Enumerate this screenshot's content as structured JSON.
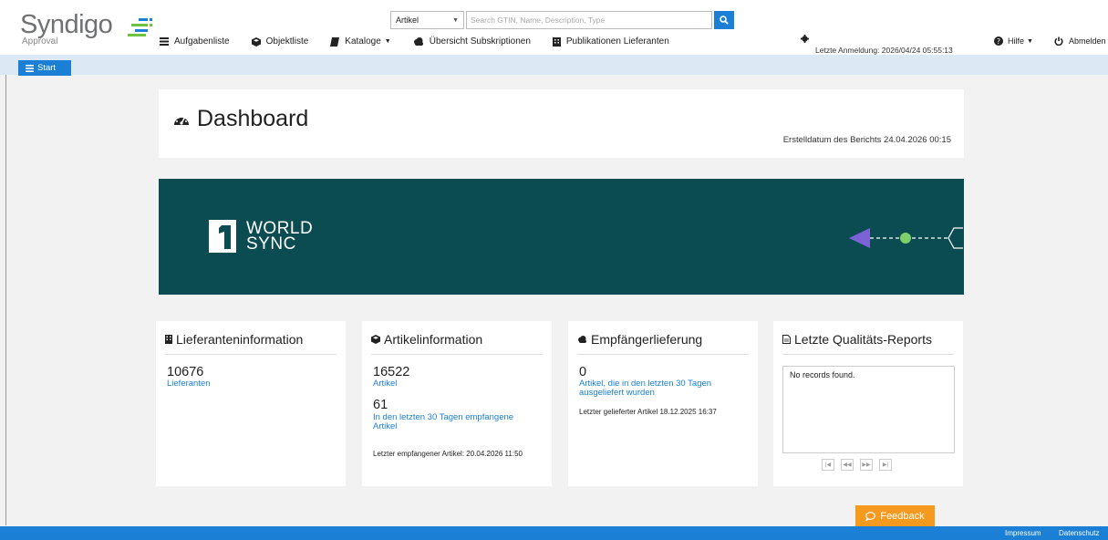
{
  "app": {
    "logo_word": "Syndigo",
    "logo_sub": "Approval",
    "brand_blue": "#1b7fd6",
    "brand_teal": "#0b4c52",
    "feedback_orange": "#f59a1e"
  },
  "search": {
    "type_selected": "Artikel",
    "placeholder": "Search GTIN, Name, Description, Type"
  },
  "nav": {
    "items": [
      {
        "label": "Aufgabenliste",
        "icon": "list-icon"
      },
      {
        "label": "Objektliste",
        "icon": "cube-icon"
      },
      {
        "label": "Kataloge",
        "icon": "book-icon",
        "dropdown": true
      },
      {
        "label": "Übersicht Subskriptionen",
        "icon": "cloud-icon"
      },
      {
        "label": "Publikationen Lieferanten",
        "icon": "building-icon"
      }
    ],
    "last_login": "Letzte Anmeldung: 2026/04/24 05:55:13",
    "help": "Hilfe",
    "logout": "Abmelden"
  },
  "subbar": {
    "start_label": "Start"
  },
  "dashboard": {
    "title": "Dashboard",
    "report_date": "Erstelldatum des Berichts 24.04.2026 00:15"
  },
  "banner": {
    "logo_line1": "WORLD",
    "logo_line2": "SYNC"
  },
  "cards": {
    "supplier": {
      "title": "Lieferanteninformation",
      "count": "10676",
      "count_label": "Lieferanten"
    },
    "article": {
      "title": "Artikelinformation",
      "count": "16522",
      "count_label": "Artikel",
      "recent_count": "61",
      "recent_label": "In den letzten 30 Tagen empfangene Artikel",
      "last_received": "Letzter empfangener Artikel: 20.04.2026 11:50"
    },
    "delivery": {
      "title": "Empfängerlieferung",
      "count": "0",
      "count_label": "Artikel, die in den letzten 30 Tagen ausgeliefert wurden",
      "last_delivered": "Letzter gelieferter Artikel 18.12.2025 16:37"
    },
    "quality": {
      "title": "Letzte Qualitäts-Reports",
      "empty": "No records found."
    }
  },
  "feedback_label": "Feedback",
  "footer": {
    "impressum": "Impressum",
    "datenschutz": "Datenschutz"
  }
}
